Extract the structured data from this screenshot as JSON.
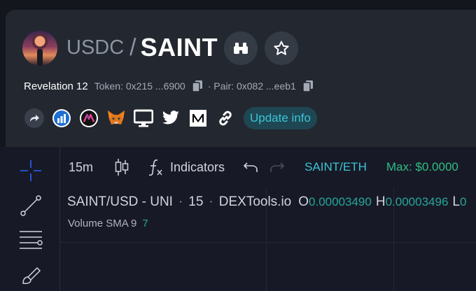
{
  "header": {
    "base_token": "USDC",
    "separator": "/",
    "quote_token": "SAINT",
    "token_name": "Revelation 12",
    "token_label": "Token: 0x215 ...6900",
    "pair_label": "· Pair: 0x082 ...eeb1",
    "update_label": "Update info"
  },
  "icons": {
    "binoculars": "binoculars-icon",
    "star": "star-icon",
    "share": "share-icon",
    "dextools": "dextools-icon",
    "maximize": "maximize-icon",
    "metamask": "metamask-icon",
    "website": "website-icon",
    "twitter": "twitter-icon",
    "medium": "medium-icon",
    "link": "link-icon"
  },
  "toolbar": {
    "interval": "15m",
    "indicators": "Indicators",
    "pair": "SAINT/ETH",
    "max_label": "Max: $0.0000"
  },
  "legend": {
    "symbol": "SAINT/USD - UNI",
    "interval": "15",
    "source": "DEXTools.io",
    "open_label": "O",
    "open_value": "0.00003490",
    "high_label": "H",
    "high_value": "0.00003496",
    "low_label": "L",
    "low_value": "0"
  },
  "volume": {
    "label": "Volume SMA 9",
    "value": "7"
  },
  "colors": {
    "accent_teal": "#3bc4d6",
    "price_green": "#26a69a",
    "max_green": "#2ebd85",
    "crosshair_blue": "#2962ff"
  }
}
